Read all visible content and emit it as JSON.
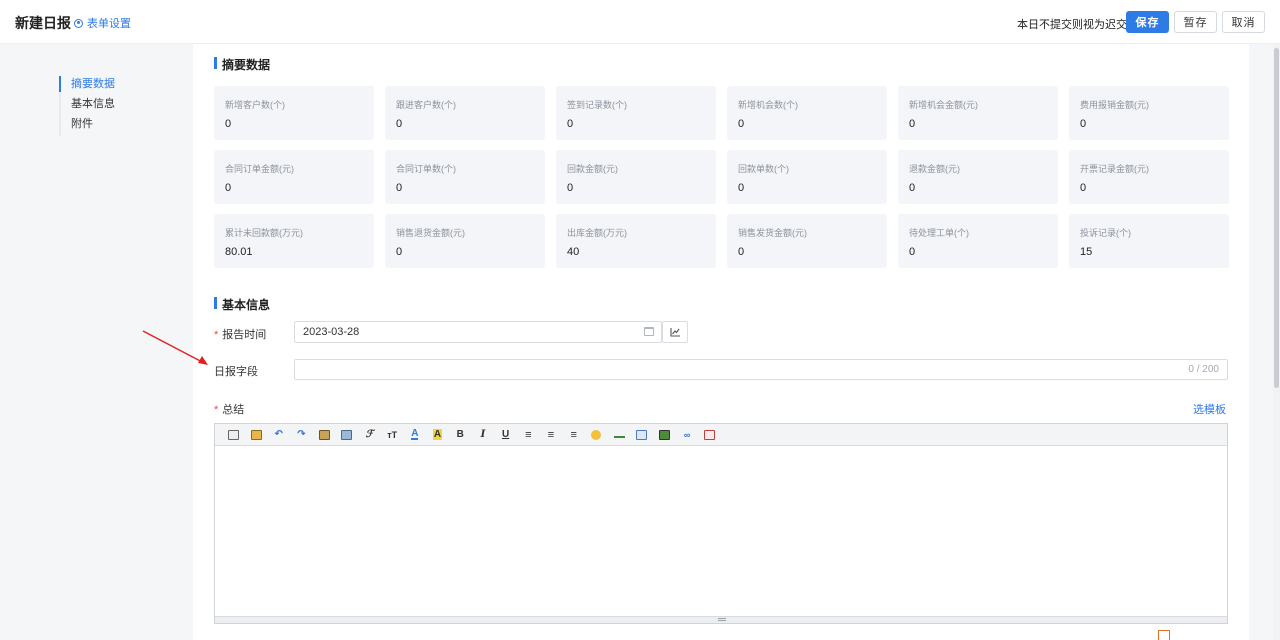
{
  "header": {
    "title": "新建日报",
    "settings_label": "表单设置",
    "warning": "本日不提交则视为迟交!",
    "save_label": "保存",
    "draft_label": "暂存",
    "cancel_label": "取消"
  },
  "sidenav": {
    "items": [
      {
        "label": "摘要数据",
        "active": true
      },
      {
        "label": "基本信息",
        "active": false
      },
      {
        "label": "附件",
        "active": false
      }
    ]
  },
  "summary": {
    "title": "摘要数据",
    "cards": [
      {
        "label": "新增客户数(个)",
        "value": "0"
      },
      {
        "label": "跟进客户数(个)",
        "value": "0"
      },
      {
        "label": "签到记录数(个)",
        "value": "0"
      },
      {
        "label": "新增机会数(个)",
        "value": "0"
      },
      {
        "label": "新增机会金额(元)",
        "value": "0"
      },
      {
        "label": "费用报销金额(元)",
        "value": "0"
      },
      {
        "label": "合同订单金额(元)",
        "value": "0"
      },
      {
        "label": "合同订单数(个)",
        "value": "0"
      },
      {
        "label": "回款金额(元)",
        "value": "0"
      },
      {
        "label": "回款单数(个)",
        "value": "0"
      },
      {
        "label": "退款金额(元)",
        "value": "0"
      },
      {
        "label": "开票记录金额(元)",
        "value": "0"
      },
      {
        "label": "累计未回款额(万元)",
        "value": "80.01"
      },
      {
        "label": "销售退货金额(元)",
        "value": "0"
      },
      {
        "label": "出库金额(万元)",
        "value": "40"
      },
      {
        "label": "销售发货金额(元)",
        "value": "0"
      },
      {
        "label": "待处理工单(个)",
        "value": "0"
      },
      {
        "label": "投诉记录(个)",
        "value": "15"
      }
    ]
  },
  "basic": {
    "title": "基本信息",
    "report_time_label": "报告时间",
    "report_time_value": "2023-03-28",
    "daily_field_label": "日报字段",
    "daily_field_counter": "0 / 200",
    "summary_label": "总结",
    "template_link": "选模板"
  },
  "colors": {
    "accent": "#2d7be5",
    "required": "#e5484d",
    "annotation_arrow": "#e02020"
  }
}
